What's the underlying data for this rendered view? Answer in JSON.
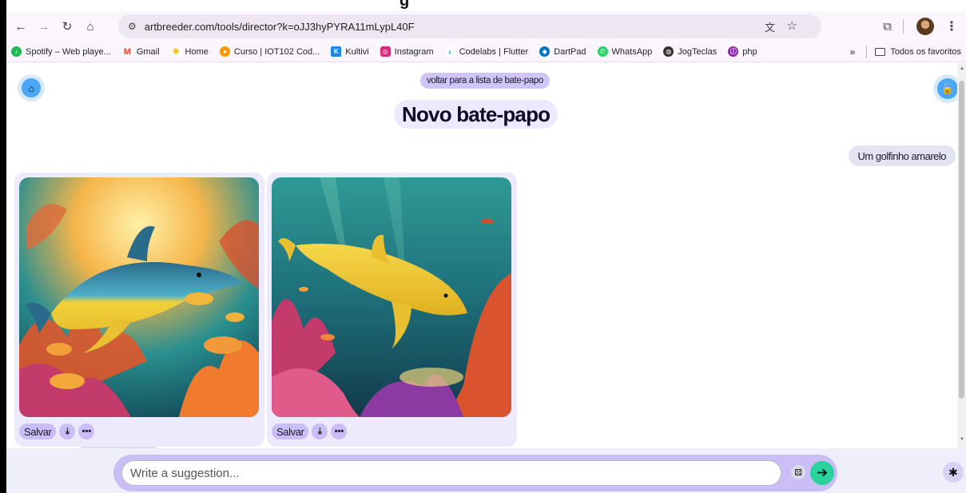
{
  "browser": {
    "heading_fragment": "g",
    "url": "artbreeder.com/tools/director?k=oJJ3hyPYRA11mLypL40F",
    "bookmarks": [
      {
        "label": "Spotify – Web playe...",
        "icon": "spotify-icon",
        "color": "#1db954"
      },
      {
        "label": "Gmail",
        "icon": "gmail-icon",
        "color": "#ea4335"
      },
      {
        "label": "Home",
        "icon": "home-app-icon",
        "color": "#fbbc04"
      },
      {
        "label": "Curso | IOT102 Cod...",
        "icon": "curso-icon",
        "color": "#ff9800"
      },
      {
        "label": "Kultivi",
        "icon": "kultivi-icon",
        "color": "#1e88e5"
      },
      {
        "label": "Instagram",
        "icon": "instagram-icon",
        "color": "#d62976"
      },
      {
        "label": "Codelabs | Flutter",
        "icon": "flutter-icon",
        "color": "#42a5f5"
      },
      {
        "label": "DartPad",
        "icon": "dartpad-icon",
        "color": "#0175c2"
      },
      {
        "label": "WhatsApp",
        "icon": "whatsapp-icon",
        "color": "#25d366"
      },
      {
        "label": "JogTeclas",
        "icon": "globe-icon",
        "color": "#333333"
      },
      {
        "label": "php",
        "icon": "php-icon",
        "color": "#8e24aa"
      }
    ],
    "bookmarks_more": "»",
    "all_bookmarks": "Todos os favoritos"
  },
  "page": {
    "back_link": "voltar para a lista de bate-papo",
    "title": "Novo bate-papo",
    "user_message": "Um golfinho amarelo",
    "results": [
      {
        "save_label": "Salvar"
      },
      {
        "save_label": "Salvar"
      }
    ]
  },
  "composer": {
    "placeholder": "Write a suggestion..."
  },
  "colors": {
    "accent_lavender": "#cbbdf6",
    "send_green": "#2ad39c",
    "home_blue": "#4aa7f5"
  }
}
